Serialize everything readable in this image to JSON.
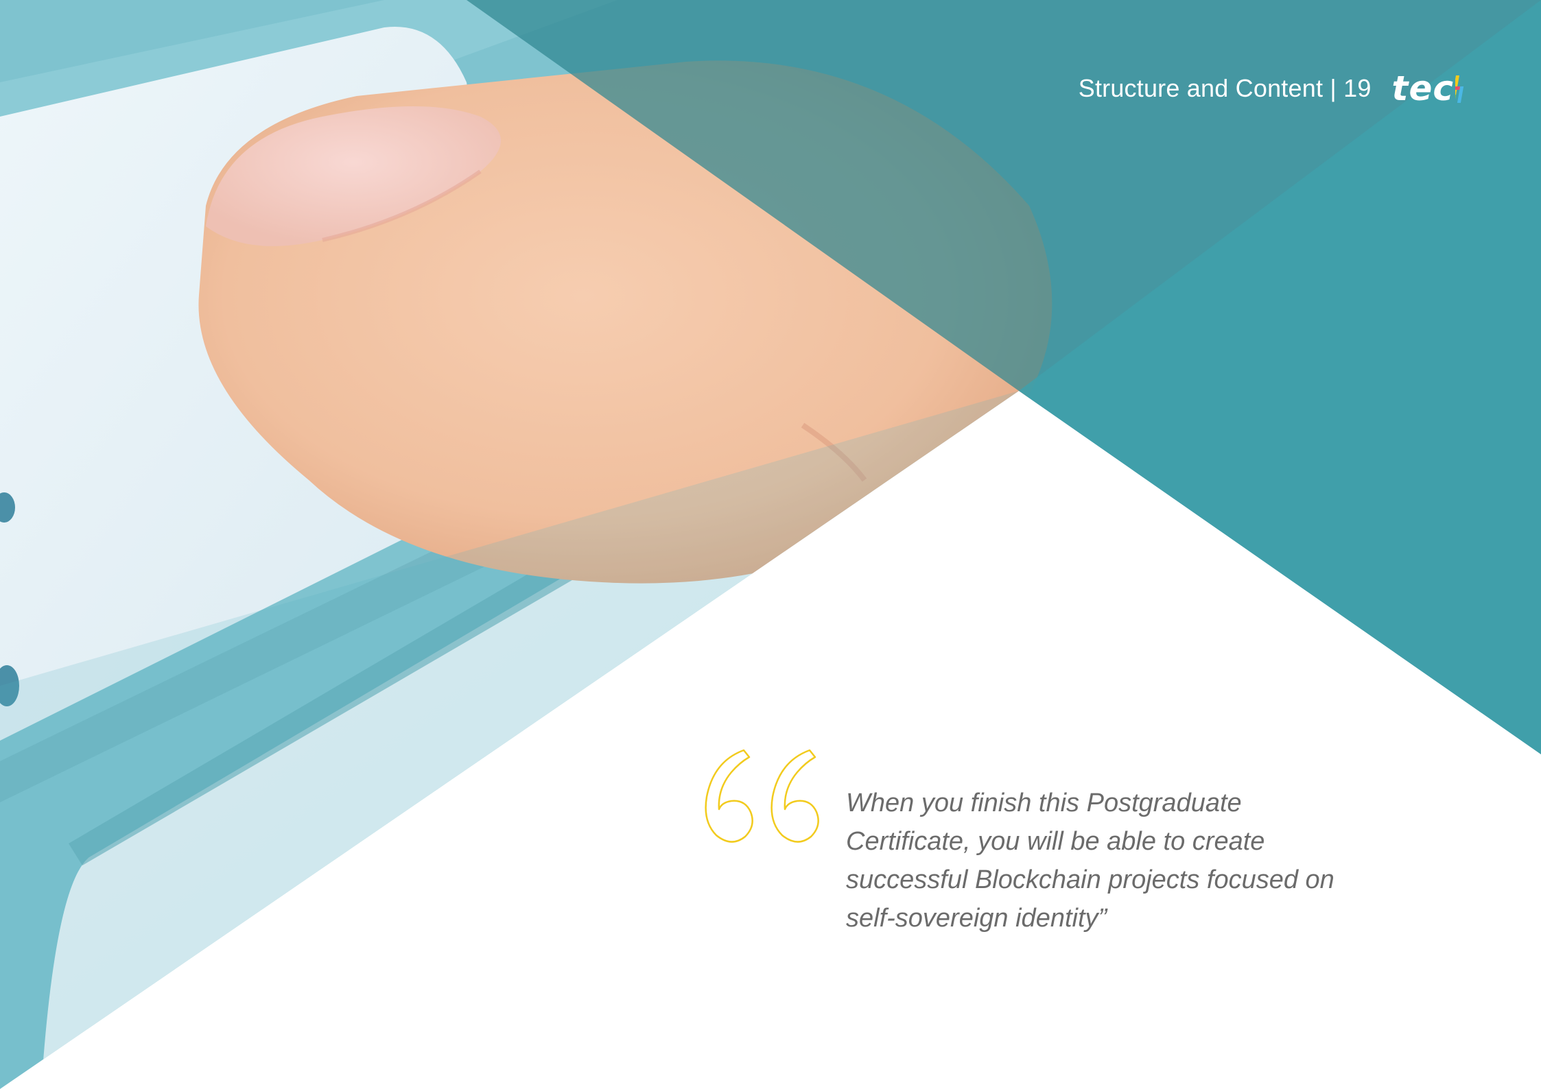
{
  "header": {
    "title": "Structure and Content | 19",
    "logo_text": "tec"
  },
  "quote": {
    "text": "When you finish this Postgraduate Certificate, you will be able to create successful Blockchain projects focused on self-sovereign identity”"
  },
  "icons": {
    "quote_mark": "open-quote-outline-icon",
    "logo_h": "colorful-h-icon"
  },
  "colors": {
    "teal_dark": "#3f8a80",
    "teal": "#3e9fa7",
    "teal_light": "#49a8b3",
    "quote_mark": "#f2cb1e",
    "quote_text": "#6b6b6b",
    "skin": "#f0c3a3",
    "keyboard": "#e6f2f7"
  }
}
